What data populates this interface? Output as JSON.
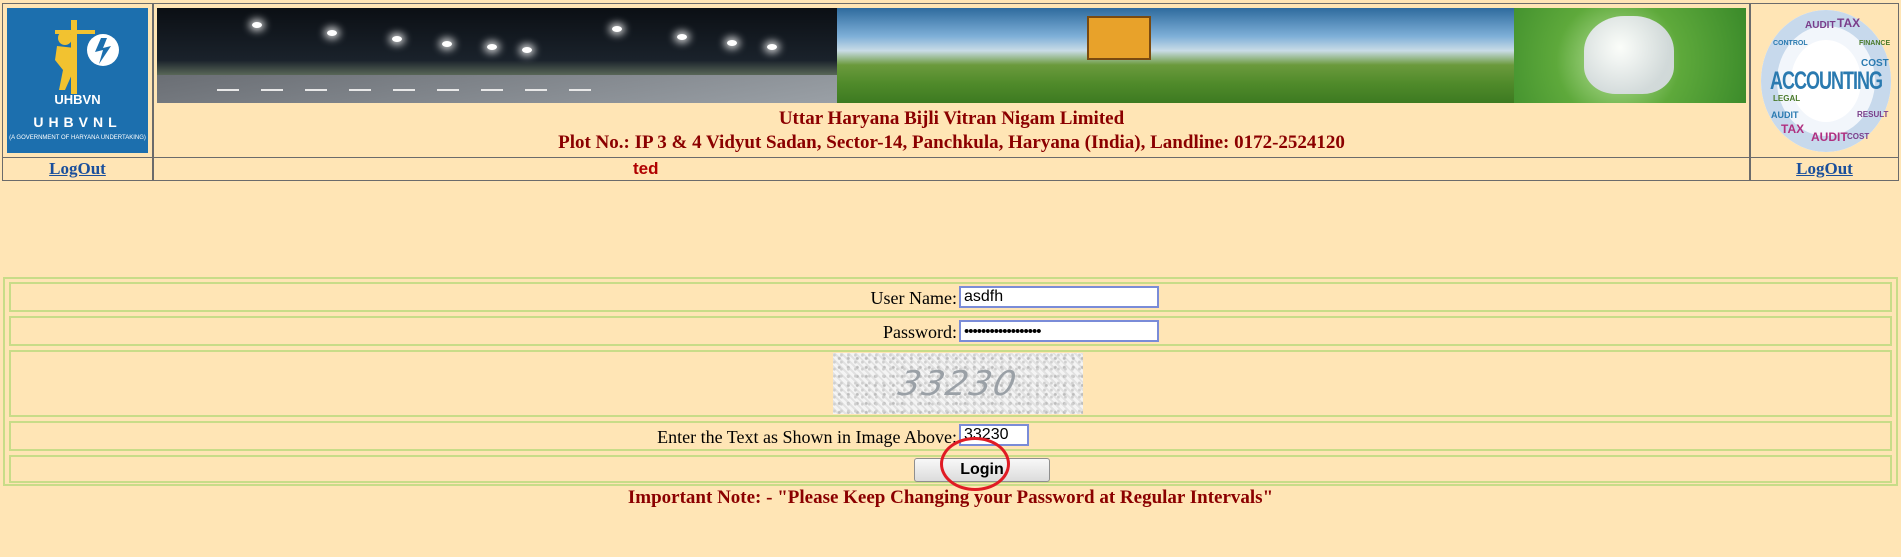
{
  "header": {
    "logo": {
      "brand_text": "UHBVN",
      "name_text": "UHBVNL",
      "tagline_text": "(A GOVERNMENT OF HARYANA UNDERTAKING)",
      "color": "#1c6fae"
    },
    "org_name": "Uttar Haryana Bijli Vitran Nigam Limited",
    "org_address": "Plot No.: IP 3 & 4 Vidyut Sadan, Sector-14, Panchkula, Haryana (India), Landline: 0172-2524120",
    "right_logo": {
      "main_word": "ACCOUNTING",
      "tag_words": [
        "AUDIT",
        "TAX",
        "FINANCE",
        "COST",
        "RESULT",
        "CONTROL",
        "LEGAL",
        "AUDIT",
        "TAX",
        "AUDIT",
        "COST"
      ]
    }
  },
  "nav": {
    "logout_left": "LogOut",
    "logout_right": "LogOut",
    "message": "ted"
  },
  "login_form": {
    "username_label": "User Name:",
    "username_value": "asdfh",
    "password_label": "Password:",
    "password_value": "••••••••••••••••••",
    "captcha_text": "33230",
    "captcha_label": "Enter the Text as Shown in Image Above:",
    "captcha_value": "33230",
    "login_button": "Login"
  },
  "important_note": "Important Note: - \"Please Keep Changing your Password at Regular Intervals\"",
  "colors": {
    "page_background": "#ffe5b5",
    "heading_text": "#8b0000",
    "link": "#1a4f9c",
    "highlight": "#e01b24"
  }
}
